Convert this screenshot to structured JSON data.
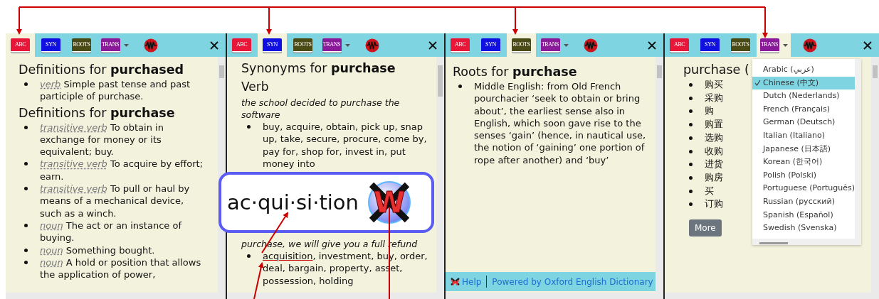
{
  "panels": [
    {
      "kind": "definitions",
      "tabs": [
        {
          "kind": "book",
          "label": "ABC",
          "color": "#e8173a",
          "selected": true
        },
        {
          "kind": "book",
          "label": "SYN",
          "color": "#1010e0",
          "selected": false
        },
        {
          "kind": "book",
          "label": "ROOTS",
          "color": "#4a4a14",
          "selected": false
        },
        {
          "kind": "book",
          "label": "TRANS",
          "color": "#8a1a9a",
          "selected": false,
          "dropdown": true
        },
        {
          "kind": "audio",
          "selected": false
        }
      ],
      "sections": [
        {
          "heading": "Definitions for **purchased**",
          "entries": [
            {
              "pos": "verb",
              "text": "Simple past tense and past participle of purchase."
            }
          ]
        },
        {
          "heading": "Definitions for **purchase**",
          "entries": [
            {
              "pos": "transitive verb",
              "text": "To obtain in exchange for money or its equivalent; buy."
            },
            {
              "pos": "transitive verb",
              "text": "To acquire by effort; earn."
            },
            {
              "pos": "transitive verb",
              "text": "To pull or haul by means of a mechanical device, such as a winch."
            },
            {
              "pos": "noun",
              "text": "The act or an instance of buying."
            },
            {
              "pos": "noun",
              "text": "Something bought."
            },
            {
              "pos": "noun",
              "text": "A hold or position that allows the application of power,"
            }
          ]
        }
      ]
    },
    {
      "kind": "synonyms",
      "tabs": [
        {
          "kind": "book",
          "label": "ABC",
          "color": "#e8173a",
          "selected": false
        },
        {
          "kind": "book",
          "label": "SYN",
          "color": "#1010e0",
          "selected": true
        },
        {
          "kind": "book",
          "label": "ROOTS",
          "color": "#4a4a14",
          "selected": false
        },
        {
          "kind": "book",
          "label": "TRANS",
          "color": "#8a1a9a",
          "selected": false,
          "dropdown": true
        },
        {
          "kind": "audio",
          "selected": false
        }
      ],
      "heading": "Synonyms for **purchase**",
      "groups": [
        {
          "pos": "Verb",
          "example": "the school decided to purchase the software",
          "words": [
            {
              "text": "buy, acquire, obtain, pick up, snap up, take, secure, procure, come by, pay for, shop for, invest in, put money into",
              "highlighted": false
            }
          ]
        },
        {
          "example": "purchase, we will give you a full refund",
          "words": [
            {
              "text": "acquisition",
              "highlighted": true
            },
            {
              "text": ", investment, buy, order, deal, bargain, property, asset, possession, holding",
              "highlighted": false
            }
          ]
        }
      ]
    },
    {
      "kind": "roots",
      "tabs": [
        {
          "kind": "book",
          "label": "ABC",
          "color": "#e8173a",
          "selected": false
        },
        {
          "kind": "book",
          "label": "SYN",
          "color": "#1010e0",
          "selected": false
        },
        {
          "kind": "book",
          "label": "ROOTS",
          "color": "#4a4a14",
          "selected": true
        },
        {
          "kind": "book",
          "label": "TRANS",
          "color": "#8a1a9a",
          "selected": false,
          "dropdown": true
        },
        {
          "kind": "audio",
          "selected": false
        }
      ],
      "heading": "Roots for **purchase**",
      "items": [
        "Middle English: from Old French pourchacier ‘seek to obtain or bring about’, the earliest sense also in English, which soon gave rise to the senses ‘gain’ (hence, in nautical use, the notion of ‘gaining’ one portion of rope after another) and ‘buy’"
      ],
      "footer": {
        "help": "Help",
        "credit": "Powered by Oxford English Dictionary"
      }
    },
    {
      "kind": "translation",
      "tabs": [
        {
          "kind": "book",
          "label": "ABC",
          "color": "#e8173a",
          "selected": false
        },
        {
          "kind": "book",
          "label": "SYN",
          "color": "#1010e0",
          "selected": false
        },
        {
          "kind": "book",
          "label": "ROOTS",
          "color": "#4a4a14",
          "selected": false
        },
        {
          "kind": "book",
          "label": "TRANS",
          "color": "#8a1a9a",
          "selected": true,
          "dropdown": true
        },
        {
          "kind": "audio",
          "selected": false
        }
      ],
      "heading": "purchase (",
      "items": [
        "购买",
        "采购",
        "购",
        "购置",
        "选购",
        "收购",
        "进货",
        "购房",
        "买",
        "订购"
      ],
      "button": "More",
      "languages": [
        {
          "label": "Arabic (عربي)",
          "selected": false
        },
        {
          "label": "Chinese (中文)",
          "selected": true
        },
        {
          "label": "Dutch (Nederlands)",
          "selected": false
        },
        {
          "label": "French (Français)",
          "selected": false
        },
        {
          "label": "German (Deutsch)",
          "selected": false
        },
        {
          "label": "Italian (Italiano)",
          "selected": false
        },
        {
          "label": "Japanese (日本語)",
          "selected": false
        },
        {
          "label": "Korean (한국어)",
          "selected": false
        },
        {
          "label": "Polish (Polski)",
          "selected": false
        },
        {
          "label": "Portuguese (Português)",
          "selected": false
        },
        {
          "label": "Russian (русский)",
          "selected": false
        },
        {
          "label": "Spanish (Español)",
          "selected": false
        },
        {
          "label": "Swedish (Svenska)",
          "selected": false
        }
      ]
    }
  ],
  "popup": {
    "text": "ac·qui·si·tion",
    "logo": "W"
  }
}
